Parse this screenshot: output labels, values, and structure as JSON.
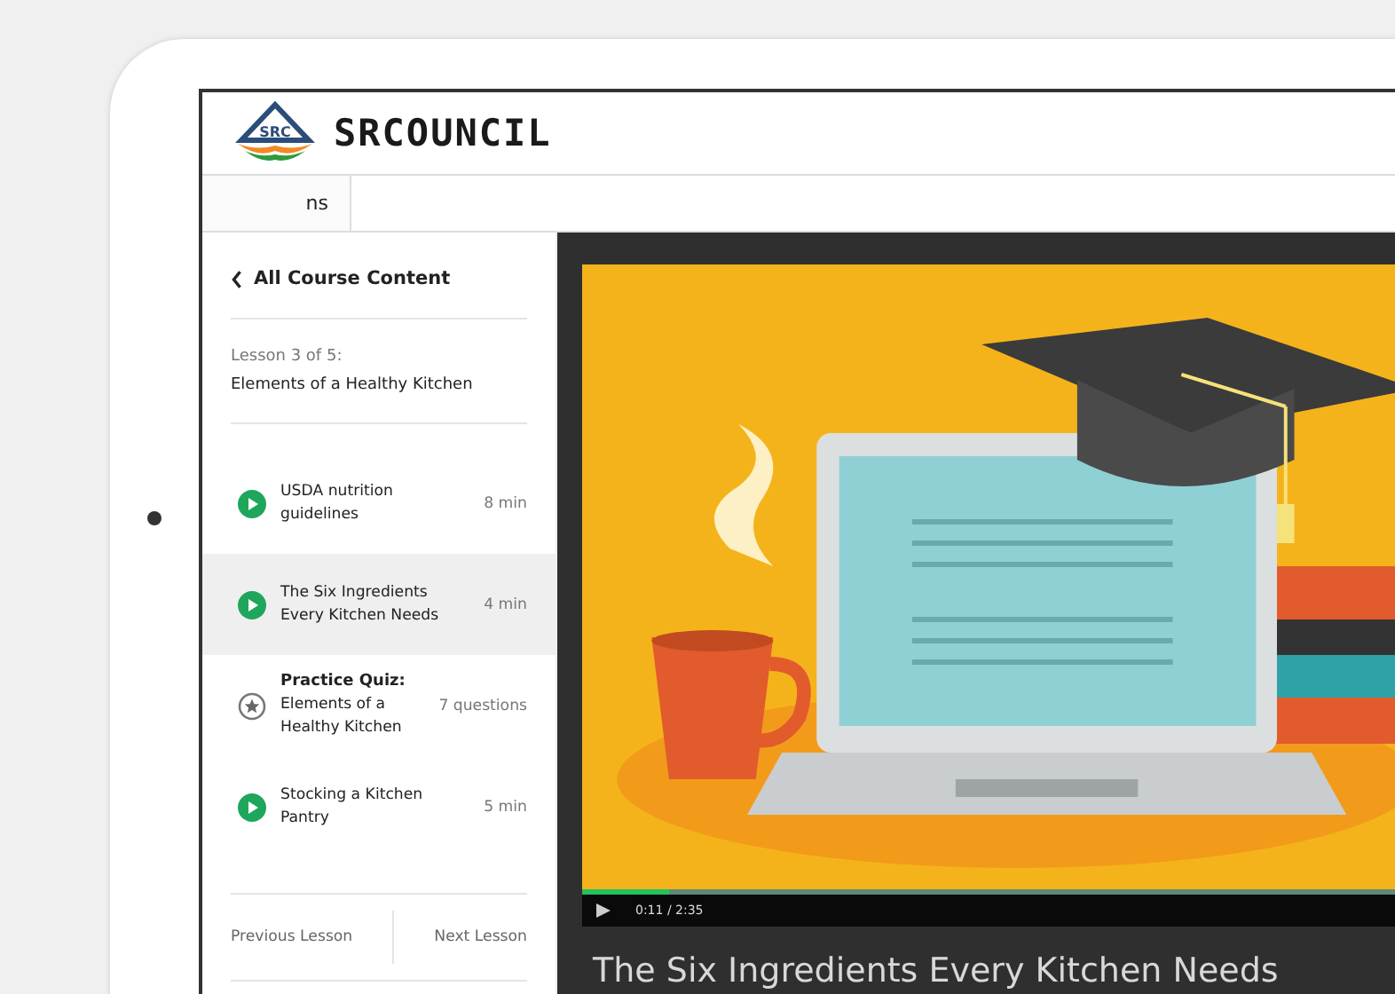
{
  "header": {
    "logo_badge": "SRC",
    "brand": "SRCOUNCIL"
  },
  "tabs": [
    {
      "label": "ns",
      "selected": true
    }
  ],
  "sidebar": {
    "back_link": "All Course Content",
    "lesson_number": "Lesson 3 of 5:",
    "lesson_title": "Elements of a Healthy Kitchen",
    "items": [
      {
        "kind": "video",
        "title": "USDA nutrition guidelines",
        "meta": "8 min",
        "selected": false
      },
      {
        "kind": "video",
        "title": "The Six Ingredients Every Kitchen Needs",
        "meta": "4 min",
        "selected": true
      },
      {
        "kind": "quiz",
        "label": "Practice Quiz:",
        "title": "Elements of a Healthy Kitchen",
        "meta": "7 questions",
        "selected": false
      },
      {
        "kind": "video",
        "title": "Stocking a Kitchen Pantry",
        "meta": "5 min",
        "selected": false
      }
    ],
    "previous": "Previous Lesson",
    "next": "Next Lesson"
  },
  "player": {
    "level": 0.107,
    "time": "0:11 / 2:35"
  },
  "video_title": "The Six Ingredients Every Kitchen Needs"
}
